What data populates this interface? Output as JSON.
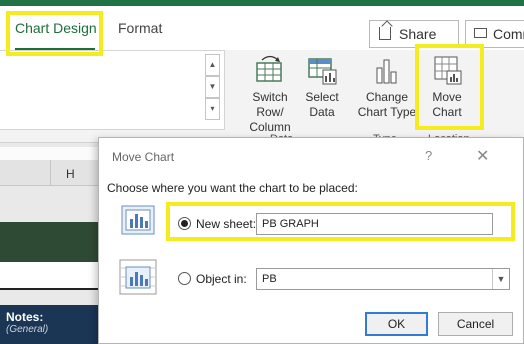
{
  "ribbon": {
    "tabs": [
      {
        "label": "Chart Design",
        "active": true
      },
      {
        "label": "Format",
        "active": false
      }
    ],
    "share_label": "Share",
    "comments_label": "Comme",
    "buttons": {
      "switch_row_column": [
        "Switch Row/",
        "Column"
      ],
      "select_data": [
        "Select",
        "Data"
      ],
      "change_chart_type": [
        "Change",
        "Chart Type"
      ],
      "move_chart": [
        "Move",
        "Chart"
      ]
    },
    "groups": {
      "data": "Data",
      "type": "Type",
      "location": "Location"
    }
  },
  "sheet": {
    "column_header": "H",
    "notes_title": "Notes:",
    "notes_subtitle": "(General)"
  },
  "dialog": {
    "title": "Move Chart",
    "help": "?",
    "close": "✕",
    "prompt": "Choose where you want the chart to be placed:",
    "new_sheet": {
      "label": "New sheet:",
      "value": "PB GRAPH",
      "selected": true
    },
    "object_in": {
      "label": "Object in:",
      "value": "PB",
      "selected": false
    },
    "ok_label": "OK",
    "cancel_label": "Cancel"
  },
  "colors": {
    "excel_green": "#217346",
    "highlight_yellow": "#f4ec1f",
    "dark_green_band": "#2f4a34",
    "notes_navy": "#1b3555",
    "ok_border_blue": "#2f7bd6"
  }
}
